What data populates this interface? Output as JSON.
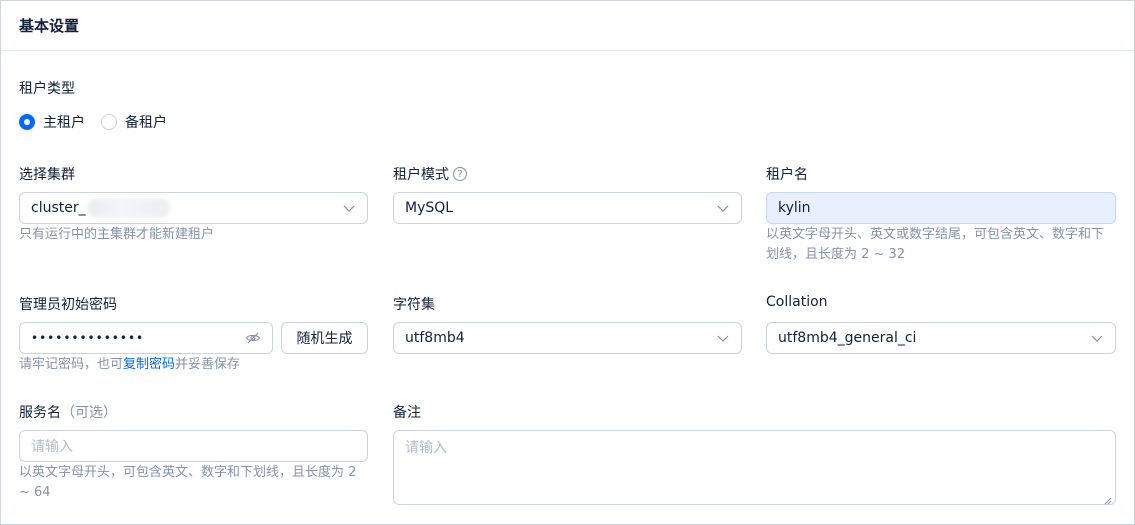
{
  "header": {
    "title": "基本设置"
  },
  "tenant_type": {
    "label": "租户类型",
    "options": [
      {
        "label": "主租户",
        "selected": true
      },
      {
        "label": "备租户",
        "selected": false
      }
    ]
  },
  "cluster": {
    "label": "选择集群",
    "value": "cluster_",
    "help": "只有运行中的主集群才能新建租户"
  },
  "tenant_mode": {
    "label": "租户模式",
    "value": "MySQL",
    "help_icon": "?"
  },
  "tenant_name": {
    "label": "租户名",
    "value": "kylin",
    "help": "以英文字母开头、英文或数字结尾，可包含英文、数字和下划线，且长度为 2 ~ 32"
  },
  "admin_password": {
    "label": "管理员初始密码",
    "value": "••••••••••••••",
    "random_button": "随机生成",
    "help_prefix": "请牢记密码，也可",
    "help_link": "复制密码",
    "help_suffix": "并妥善保存"
  },
  "charset": {
    "label": "字符集",
    "value": "utf8mb4"
  },
  "collation": {
    "label": "Collation",
    "value": "utf8mb4_general_ci"
  },
  "service_name": {
    "label": "服务名",
    "optional": "（可选）",
    "placeholder": "请输入",
    "help": "以英文字母开头，可包含英文、数字和下划线，且长度为 2 ~ 64"
  },
  "remark": {
    "label": "备注",
    "placeholder": "请输入"
  },
  "colors": {
    "primary": "#006aff",
    "text": "#132039",
    "muted": "#8592ad",
    "border": "#cdd3de",
    "autofill": "#e8f0fe"
  }
}
